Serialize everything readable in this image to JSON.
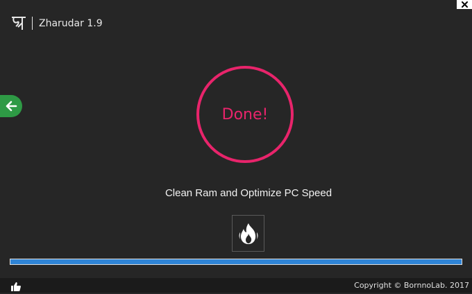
{
  "window": {
    "app_title": "Zharudar 1.9",
    "logo_icon": "bengali-letter-logo",
    "close_icon": "close-icon"
  },
  "status": {
    "ring_text": "Done!",
    "ring_color": "#e8246b"
  },
  "main": {
    "subtitle": "Clean Ram and Optimize PC Speed",
    "clean_button_icon": "fire-icon",
    "back_button_icon": "arrow-left-icon",
    "back_button_color": "#2e9a45"
  },
  "progress": {
    "percent": 100,
    "fill_color": "#2f84d6"
  },
  "footer": {
    "like_icon": "thumbs-up-icon",
    "copyright": "Copyright © BornnoLab. 2017"
  }
}
